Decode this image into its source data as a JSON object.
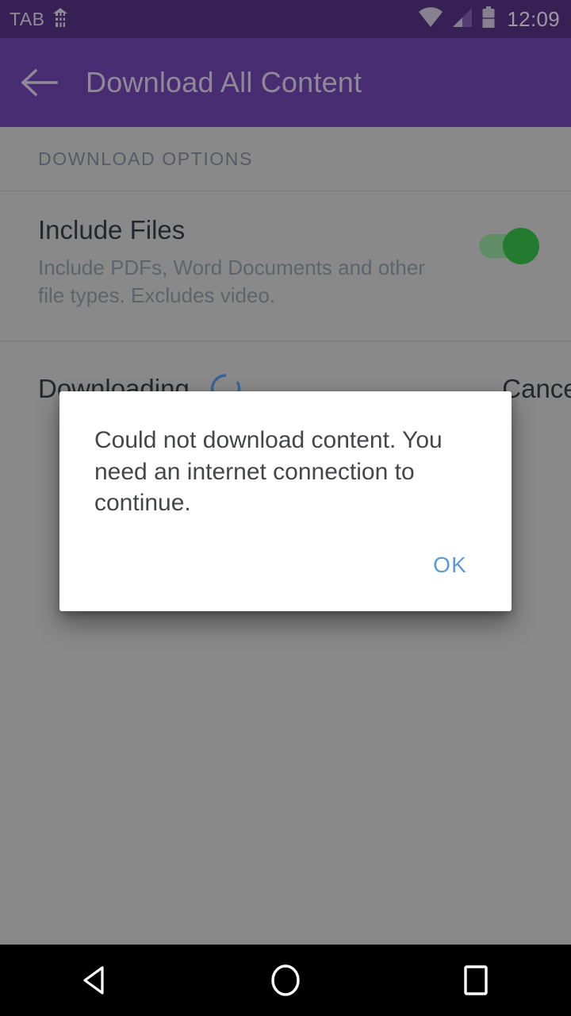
{
  "status_bar": {
    "app_tag": "TAB",
    "app_tag_icon": "building-icon",
    "wifi_icon": "wifi-icon",
    "signal_icon": "cell-signal-icon",
    "battery_icon": "battery-icon",
    "clock": "12:09",
    "background_color": "#472a6b",
    "text_color": "#b9b2c4"
  },
  "app_bar": {
    "back_icon": "back-arrow-icon",
    "title": "Download All Content",
    "background_color": "#5e3a92",
    "title_color": "#b8b0c2"
  },
  "content": {
    "section_header": "DOWNLOAD OPTIONS",
    "rows": [
      {
        "title": "Include Files",
        "description": "Include PDFs, Word Documents and other file types. Excludes video.",
        "toggle_state": "on",
        "toggle_track_color": "#7cb583",
        "toggle_thumb_color": "#2e9e3e"
      }
    ],
    "download_status": {
      "label": "Downloading",
      "spinner_icon": "loading-spinner-icon",
      "spinner_color": "#4a7fc1",
      "cancel_label": "Cancel"
    }
  },
  "dialog": {
    "message": "Could not download content. You need an internet connection to continue.",
    "ok_label": "OK",
    "ok_color": "#5b9bd5",
    "background_color": "#ffffff"
  },
  "nav_bar": {
    "back_icon": "nav-back-triangle-icon",
    "home_icon": "nav-home-circle-icon",
    "recents_icon": "nav-recents-square-icon",
    "background_color": "#000000"
  }
}
